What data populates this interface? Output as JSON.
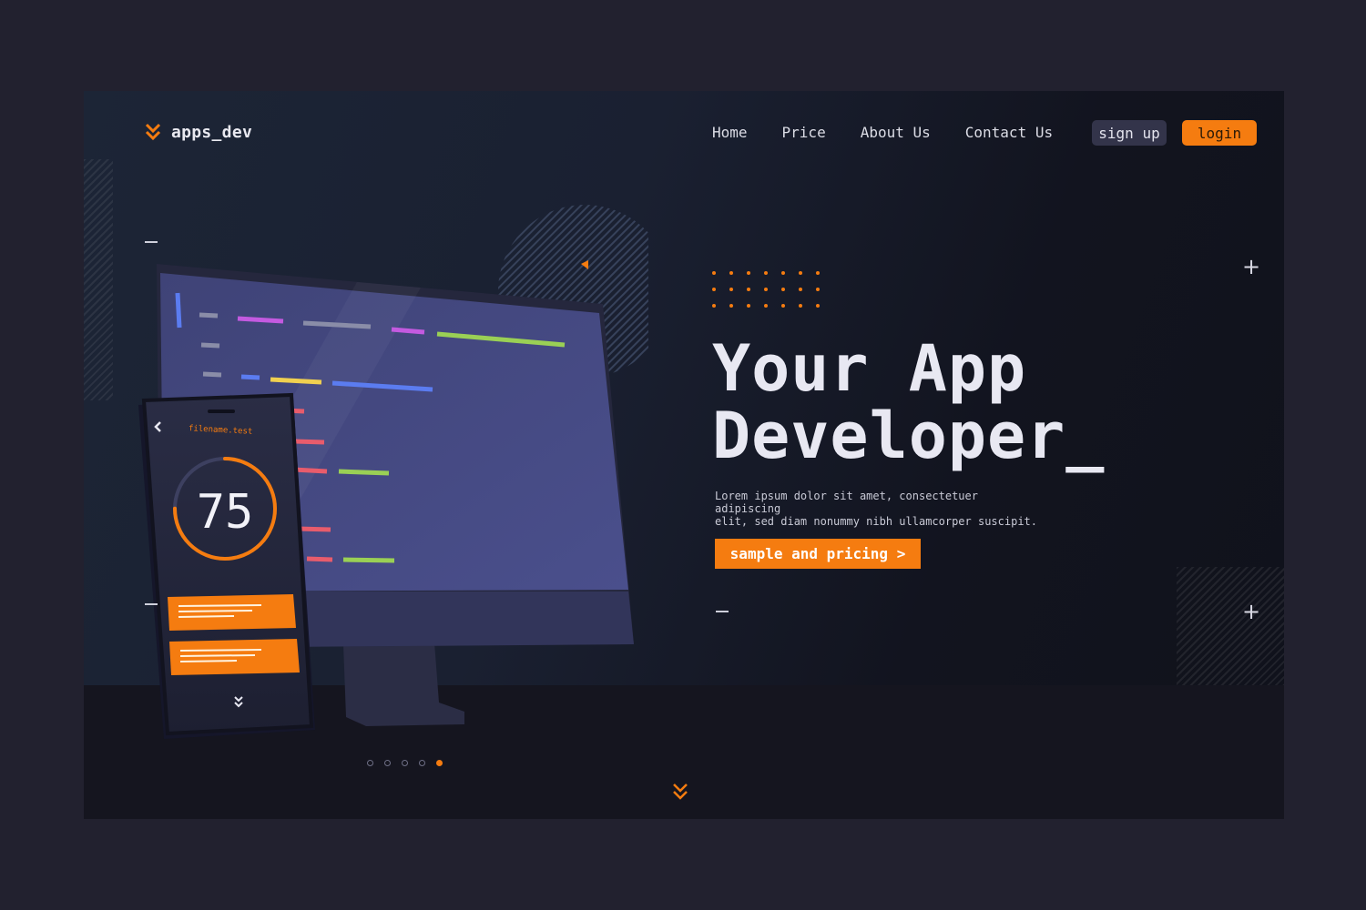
{
  "brand": {
    "name": "apps_dev",
    "accent": "#f57c10",
    "logo_icon": "chevron-double-down-icon"
  },
  "nav": {
    "items": [
      {
        "label": "Home"
      },
      {
        "label": "Price"
      },
      {
        "label": "About Us"
      },
      {
        "label": "Contact Us"
      }
    ],
    "signup_label": "sign up",
    "login_label": "login"
  },
  "hero": {
    "headline_line1": "Your App",
    "headline_line2": "Developer_",
    "description_line1": "Lorem ipsum dolor sit amet, consectetuer adipiscing",
    "description_line2": "elit, sed diam nonummy nibh ullamcorper suscipit.",
    "cta_label": "sample and pricing >"
  },
  "phone": {
    "filename": "filename.test",
    "score": "75",
    "progress": 0.75
  },
  "pager": {
    "count": 5,
    "active_index": 4
  },
  "colors": {
    "background": "#22212f",
    "panel": "#1a2031",
    "text": "#e8e8f2",
    "button_dark": "#33344a"
  }
}
